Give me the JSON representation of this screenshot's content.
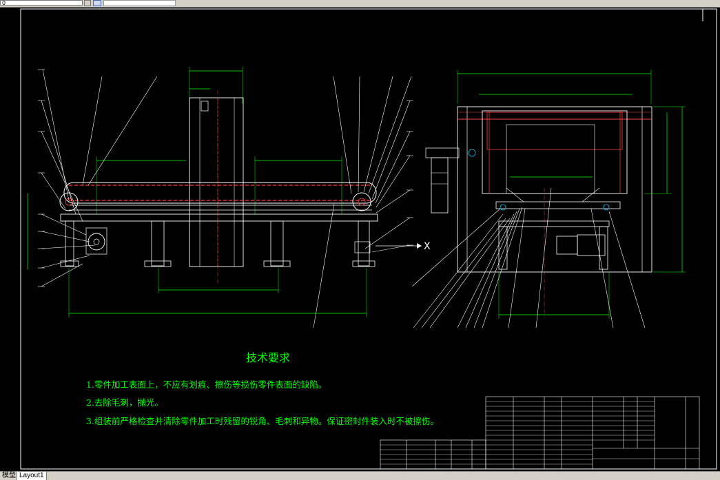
{
  "toolbar": {
    "command_value": "0",
    "layer_value": ""
  },
  "tabs": {
    "model": "模型",
    "layout": "Layout1"
  },
  "drawing": {
    "tech_title": "技术要求",
    "tech_requirements": [
      "1.零件加工表面上，不应有划痕、擦伤等损伤零件表面的缺陷。",
      "2.去除毛刺，抛光。",
      "3.组装前严格检查并清除零件加工时残留的锐角、毛刺和异物。保证密封件装入时不被擦伤。"
    ],
    "axis_mark": "X",
    "colors": {
      "background": "#000000",
      "frame": "#ffffff",
      "outline": "#ffffff",
      "chain": "#ff4040",
      "dimension": "#00ff00",
      "centerline": "#ff4040",
      "leader": "#ffffff"
    }
  }
}
